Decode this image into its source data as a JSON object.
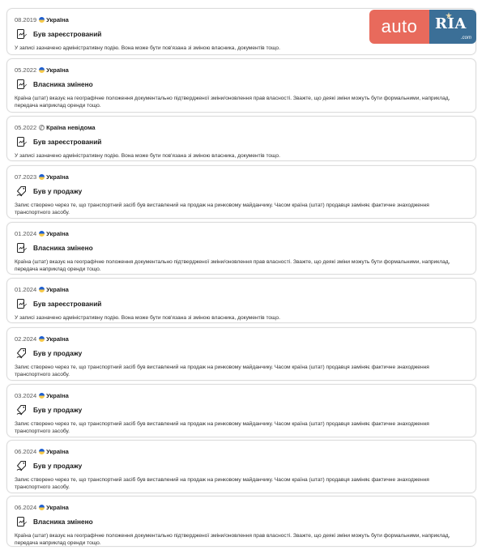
{
  "logo": {
    "part1": "auto",
    "part2": "RIA",
    "suffix": ".com"
  },
  "events": [
    {
      "date": "08.2019",
      "flag": "ua",
      "country": "Україна",
      "icon": "document-registration-icon",
      "title": "Був зареєстрований",
      "description": "У записі зазначено адміністративну подію. Вона може бути пов'язана зі зміною власника, документів тощо."
    },
    {
      "date": "05.2022",
      "flag": "ua",
      "country": "Україна",
      "icon": "document-registration-icon",
      "title": "Власника змінено",
      "description": "Країна (штат) вказує на географічне положення документально підтвердженої зміни/оновлення прав власності. Зважте, що деякі зміни можуть бути формальними, наприклад, передача наприклад оренди тощо."
    },
    {
      "date": "05.2022",
      "flag": "unknown",
      "country": "Країна невідома",
      "icon": "document-registration-icon",
      "title": "Був зареєстрований",
      "description": "У записі зазначено адміністративну подію. Вона може бути пов'язана зі зміною власника, документів тощо."
    },
    {
      "date": "07.2023",
      "flag": "ua",
      "country": "Україна",
      "icon": "price-tag-hand-icon",
      "title": "Був у продажу",
      "description": "Запис створено через те, що транспортний засіб був виставлений на продаж на ринковому майданчику. Часом країна (штат) продавця заміняє фактичне знаходження транспортного засобу."
    },
    {
      "date": "01.2024",
      "flag": "ua",
      "country": "Україна",
      "icon": "document-registration-icon",
      "title": "Власника змінено",
      "description": "Країна (штат) вказує на географічне положення документально підтвердженої зміни/оновлення прав власності. Зважте, що деякі зміни можуть бути формальними, наприклад, передача наприклад оренди тощо."
    },
    {
      "date": "01.2024",
      "flag": "ua",
      "country": "Україна",
      "icon": "document-registration-icon",
      "title": "Був зареєстрований",
      "description": "У записі зазначено адміністративну подію. Вона може бути пов'язана зі зміною власника, документів тощо."
    },
    {
      "date": "02.2024",
      "flag": "ua",
      "country": "Україна",
      "icon": "price-tag-hand-icon",
      "title": "Був у продажу",
      "description": "Запис створено через те, що транспортний засіб був виставлений на продаж на ринковому майданчику. Часом країна (штат) продавця заміняє фактичне знаходження транспортного засобу."
    },
    {
      "date": "03.2024",
      "flag": "ua",
      "country": "Україна",
      "icon": "price-tag-hand-icon",
      "title": "Був у продажу",
      "description": "Запис створено через те, що транспортний засіб був виставлений на продаж на ринковому майданчику. Часом країна (штат) продавця заміняє фактичне знаходження транспортного засобу."
    },
    {
      "date": "06.2024",
      "flag": "ua",
      "country": "Україна",
      "icon": "price-tag-hand-icon",
      "title": "Був у продажу",
      "description": "Запис створено через те, що транспортний засіб був виставлений на продаж на ринковому майданчику. Часом країна (штат) продавця заміняє фактичне знаходження транспортного засобу."
    },
    {
      "date": "06.2024",
      "flag": "ua",
      "country": "Україна",
      "icon": "document-registration-icon",
      "title": "Власника змінено",
      "description": "Країна (штат) вказує на географічне положення документально підтвердженої зміни/оновлення прав власності. Зважте, що деякі зміни можуть бути формальними, наприклад, передача наприклад оренди тощо."
    }
  ]
}
